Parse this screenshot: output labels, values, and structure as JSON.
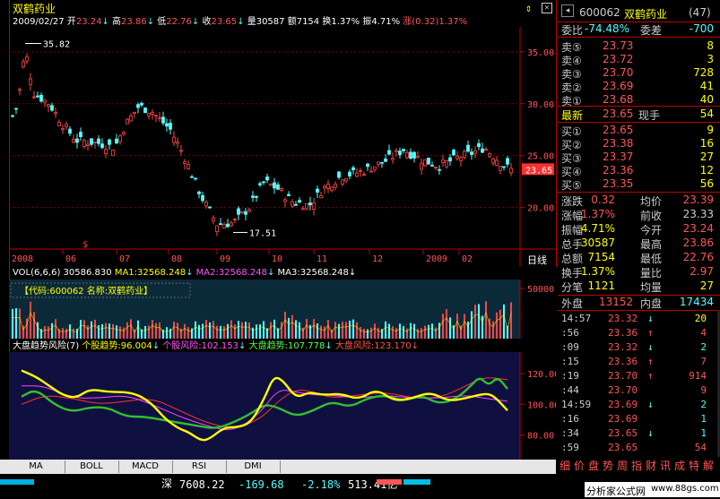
{
  "stock": {
    "name": "双鹤药业",
    "code": "600062",
    "count": "(47)"
  },
  "header_line": {
    "date": "2009/02/27",
    "open_label": "开",
    "open": "23.24",
    "open_arrow": "↓",
    "high_label": "高",
    "high": "23.86",
    "high_arrow": "↓",
    "low_label": "低",
    "low": "22.76",
    "low_arrow": "↓",
    "close_label": "收",
    "close": "23.65",
    "close_arrow": "↓",
    "vol_label": "量",
    "vol": "30587",
    "amt_label": "额",
    "amt": "7154",
    "turn_label": "换",
    "turn": "1.37%",
    "amp_label": "振",
    "amp": "4.71%",
    "chg_label": "涨",
    "chg": "(0.32)",
    "chg_pct": "1.37%"
  },
  "price_chart": {
    "y_ticks": [
      "35.00",
      "30.00",
      "25.00",
      "20.00"
    ],
    "high_mark": "35.82",
    "low_mark": "17.51",
    "last_price_tag": "23.65",
    "x_ticks": [
      "2008",
      "06",
      "07",
      "08",
      "09",
      "10",
      "11",
      "12",
      "2009",
      "02"
    ],
    "x_axis_label": "日线",
    "marker": "$"
  },
  "volume_chart": {
    "legend": "VOL(6,6,6)",
    "vol_value": "30586.830",
    "ma1": "MA1:32568.248",
    "ma2": "MA2:32568.248",
    "ma3": "MA3:32568.248",
    "arrow": "↓",
    "box_text": "【代码:600062 名称:双鹤药业】",
    "y_tick": "50000"
  },
  "indicator_chart": {
    "legend": "大盘趋势风险(7)",
    "s1": "个股趋势:96.004",
    "s2": "个股风险:102.153",
    "s3": "大盘趋势:107.778",
    "s4": "大盘风险:123.170",
    "arrow": "↓",
    "y_ticks": [
      "120.00",
      "100.00",
      "80.00"
    ]
  },
  "tabs": [
    "MA",
    "BOLL",
    "MACD",
    "RSI",
    "DMI"
  ],
  "quote": {
    "wb_label": "委比",
    "wb": "-74.48%",
    "wc_label": "委差",
    "wc": "-700",
    "sells": [
      {
        "label": "卖⑤",
        "price": "23.73",
        "vol": "8"
      },
      {
        "label": "卖④",
        "price": "23.72",
        "vol": "3"
      },
      {
        "label": "卖③",
        "price": "23.70",
        "vol": "728"
      },
      {
        "label": "卖②",
        "price": "23.69",
        "vol": "41"
      },
      {
        "label": "卖①",
        "price": "23.68",
        "vol": "40"
      }
    ],
    "last_label": "最新",
    "last": "23.65",
    "hand_label": "现手",
    "hand": "54",
    "buys": [
      {
        "label": "买①",
        "price": "23.65",
        "vol": "9"
      },
      {
        "label": "买②",
        "price": "23.38",
        "vol": "16"
      },
      {
        "label": "买③",
        "price": "23.37",
        "vol": "27"
      },
      {
        "label": "买④",
        "price": "23.36",
        "vol": "12"
      },
      {
        "label": "买⑤",
        "price": "23.35",
        "vol": "56"
      }
    ],
    "stats": [
      {
        "l1": "涨跌",
        "v1": "0.32",
        "l2": "均价",
        "v2": "23.39"
      },
      {
        "l1": "涨幅",
        "v1": "1.37%",
        "l2": "前收",
        "v2": "23.33"
      },
      {
        "l1": "振幅",
        "v1": "4.71%",
        "l2": "今开",
        "v2": "23.24"
      },
      {
        "l1": "总手",
        "v1": "30587",
        "l2": "最高",
        "v2": "23.86"
      },
      {
        "l1": "总额",
        "v1": "7154",
        "l2": "最低",
        "v2": "22.76"
      },
      {
        "l1": "换手",
        "v1": "1.37%",
        "l2": "量比",
        "v2": "2.97"
      },
      {
        "l1": "分笔",
        "v1": "1121",
        "l2": "均量",
        "v2": "27"
      }
    ],
    "outer_label": "外盘",
    "outer": "13152",
    "inner_label": "内盘",
    "inner": "17434"
  },
  "ticks": [
    {
      "time": "14:57",
      "price": "23.32",
      "arrow": "↓",
      "vol": "20"
    },
    {
      "time": ":56",
      "price": "23.36",
      "arrow": "↑",
      "vol": "4"
    },
    {
      "time": ":09",
      "price": "23.32",
      "arrow": "↓",
      "vol": "2"
    },
    {
      "time": ":15",
      "price": "23.36",
      "arrow": "↑",
      "vol": "7"
    },
    {
      "time": ":19",
      "price": "23.70",
      "arrow": "↑",
      "vol": "914"
    },
    {
      "time": ":44",
      "price": "23.70",
      "arrow": "",
      "vol": "9"
    },
    {
      "time": "14:59",
      "price": "23.69",
      "arrow": "↓",
      "vol": "2"
    },
    {
      "time": ":16",
      "price": "23.69",
      "arrow": "",
      "vol": "1"
    },
    {
      "time": ":34",
      "price": "23.65",
      "arrow": "↓",
      "vol": "1"
    },
    {
      "time": ":59",
      "price": "23.65",
      "arrow": "",
      "vol": "54"
    }
  ],
  "bottom_menu": [
    "细",
    "价",
    "盘",
    "势",
    "周",
    "指",
    "财",
    "讯",
    "成",
    "特",
    "解"
  ],
  "status": {
    "index_name": "深",
    "index_val": "7608.22",
    "index_chg": "-169.68",
    "index_pct": "-2.18%",
    "index_amt": "513.41亿",
    "watermark": "分析家公式网",
    "watermark_url": "www.88gs.com"
  },
  "colors": {
    "up": "#ff4444",
    "down": "#54fcfc",
    "yellow": "#ffff00",
    "white": "#ffffff",
    "frame": "#b00000"
  }
}
